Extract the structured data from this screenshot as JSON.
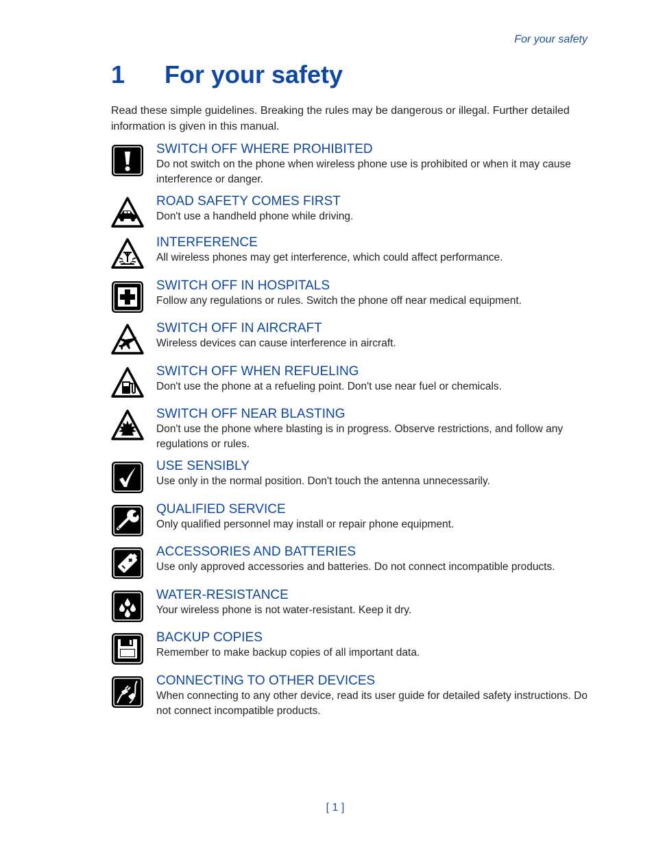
{
  "header": {
    "running_title": "For your safety"
  },
  "chapter": {
    "number": "1",
    "title": "For your safety"
  },
  "intro": "Read these simple guidelines. Breaking the rules may be dangerous or illegal. Further detailed information is given in this manual.",
  "items": [
    {
      "icon": "exclamation-icon",
      "title": "SWITCH OFF WHERE PROHIBITED",
      "description": "Do not switch on the phone when wireless phone use is prohibited or when it may cause interference or danger."
    },
    {
      "icon": "car-warning-icon",
      "title": "ROAD SAFETY COMES FIRST",
      "description": "Don't use a handheld phone while driving."
    },
    {
      "icon": "interference-warning-icon",
      "title": "INTERFERENCE",
      "description": "All wireless phones may get interference, which could affect performance."
    },
    {
      "icon": "medical-cross-icon",
      "title": "SWITCH OFF IN HOSPITALS",
      "description": "Follow any regulations or rules. Switch the phone off near medical equipment."
    },
    {
      "icon": "aircraft-warning-icon",
      "title": "SWITCH OFF IN AIRCRAFT",
      "description": "Wireless devices can cause interference in aircraft."
    },
    {
      "icon": "fuel-pump-warning-icon",
      "title": "SWITCH OFF WHEN REFUELING",
      "description": "Don't use the phone at a refueling point. Don't use near fuel or chemicals."
    },
    {
      "icon": "blasting-warning-icon",
      "title": "SWITCH OFF NEAR BLASTING",
      "description": "Don't use the phone where blasting is in progress. Observe restrictions, and follow any regulations or rules."
    },
    {
      "icon": "checkmark-icon",
      "title": "USE SENSIBLY",
      "description": "Use only in the normal position. Don't touch the antenna unnecessarily."
    },
    {
      "icon": "wrench-icon",
      "title": "QUALIFIED SERVICE",
      "description": "Only qualified personnel may install or repair phone equipment."
    },
    {
      "icon": "battery-icon",
      "title": "ACCESSORIES AND BATTERIES",
      "description": "Use only approved accessories and batteries. Do not connect incompatible products."
    },
    {
      "icon": "water-drops-icon",
      "title": "WATER-RESISTANCE",
      "description": "Your wireless phone is not water-resistant. Keep it dry."
    },
    {
      "icon": "floppy-disk-icon",
      "title": "BACKUP COPIES",
      "description": "Remember to make backup copies of all important data."
    },
    {
      "icon": "plug-connector-icon",
      "title": "CONNECTING TO OTHER DEVICES",
      "description": "When connecting to any other device, read its user guide for detailed safety instructions. Do not connect incompatible products."
    }
  ],
  "footer": {
    "page_number": "[ 1 ]"
  },
  "colors": {
    "heading_blue": "#0d47a1",
    "body_text": "#222222",
    "icon_black": "#000000"
  }
}
